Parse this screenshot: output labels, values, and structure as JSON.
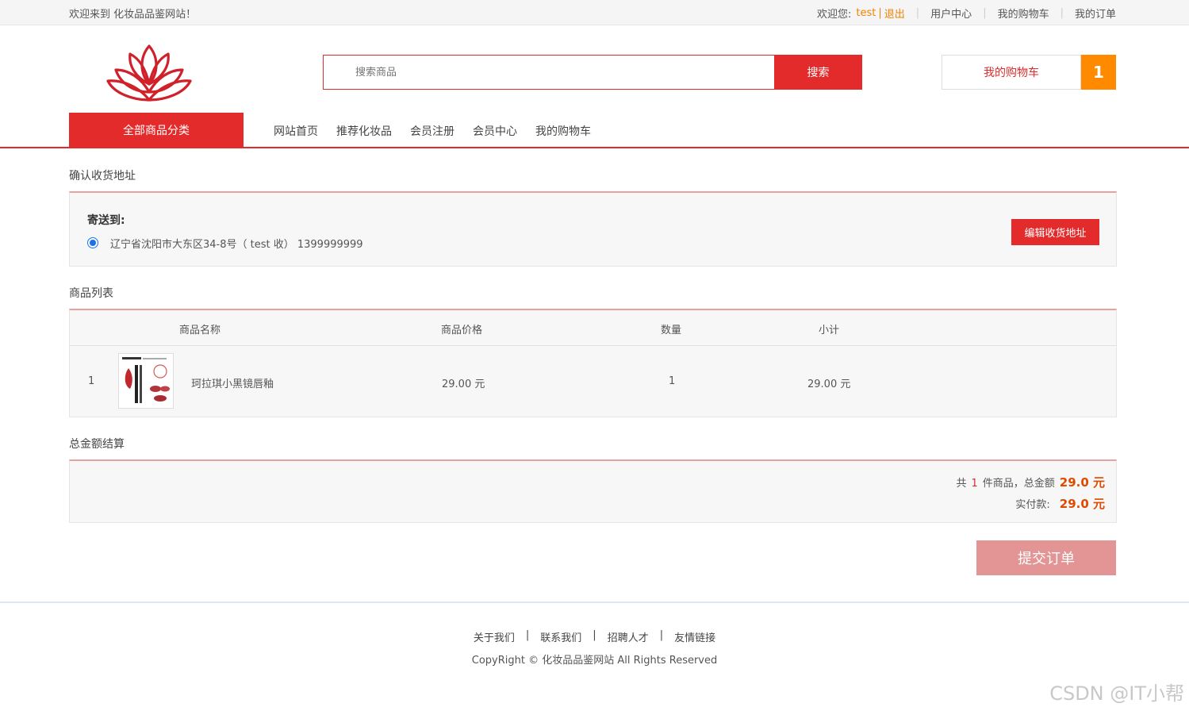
{
  "topbar": {
    "welcome": "欢迎来到 化妆品品鉴网站！",
    "greeting": "欢迎您:",
    "username": "test",
    "divider": "|",
    "logout": "退出",
    "user_center": "用户中心",
    "my_cart": "我的购物车",
    "my_orders": "我的订单",
    "sep": "|"
  },
  "header": {
    "search_placeholder": "搜索商品",
    "search_button": "搜索",
    "cart_label": "我的购物车",
    "cart_count": "1",
    "brand_color": "#e32b2b"
  },
  "nav": {
    "all_categories": "全部商品分类",
    "links": [
      "网站首页",
      "推荐化妆品",
      "会员注册",
      "会员中心",
      "我的购物车"
    ]
  },
  "address": {
    "section_title": "确认收货地址",
    "ship_to": "寄送到:",
    "address_line": "辽宁省沈阳市大东区34-8号（ test 收） 1399999999",
    "edit_button": "编辑收货地址"
  },
  "goods": {
    "section_title": "商品列表",
    "columns": [
      "商品名称",
      "商品价格",
      "数量",
      "小计"
    ],
    "rows": [
      {
        "index": "1",
        "name": "珂拉琪小黑镜唇釉",
        "price": "29.00 元",
        "qty": "1",
        "subtotal": "29.00 元",
        "thumb_icon": "lip-gloss-product-image"
      }
    ]
  },
  "total": {
    "section_title": "总金额结算",
    "count_prefix": "共",
    "count": "1",
    "count_suffix": "件商品，总金额",
    "total_amount": "29.0 元",
    "paid_label": "实付款:",
    "paid_amount": "29.0 元"
  },
  "submit_button": "提交订单",
  "footer": {
    "links": [
      "关于我们",
      "联系我们",
      "招聘人才",
      "友情链接"
    ],
    "sep": "|",
    "copyright": "CopyRight © 化妆品品鉴网站 All Rights Reserved"
  },
  "watermark": "CSDN @IT小帮"
}
